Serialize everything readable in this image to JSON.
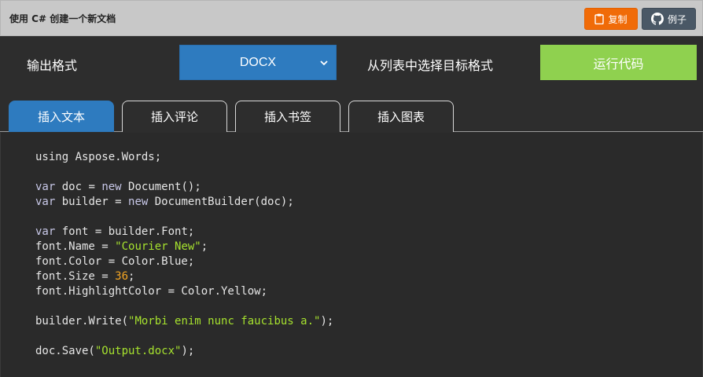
{
  "window": {
    "title": "使用 C# 创建一个新文档"
  },
  "toolbar": {
    "copy_label": "复制",
    "example_label": "例子",
    "copy_color": "#f06b08",
    "example_color": "#4a5866"
  },
  "controls": {
    "output_format_label": "输出格式",
    "format_selected": "DOCX",
    "hint": "从列表中选择目标格式",
    "run_label": "运行代码",
    "run_color": "#8fd14f",
    "select_color": "#2e7bbf"
  },
  "tabs": [
    {
      "label": "插入文本",
      "active": true
    },
    {
      "label": "插入评论",
      "active": false
    },
    {
      "label": "插入书签",
      "active": false
    },
    {
      "label": "插入图表",
      "active": false
    }
  ],
  "code": {
    "lines": [
      [
        {
          "t": "using Aspose.Words;",
          "c": ""
        }
      ],
      [],
      [
        {
          "t": "var",
          "c": "kw"
        },
        {
          "t": " doc = ",
          "c": ""
        },
        {
          "t": "new",
          "c": "kw"
        },
        {
          "t": " Document();",
          "c": ""
        }
      ],
      [
        {
          "t": "var",
          "c": "kw"
        },
        {
          "t": " builder = ",
          "c": ""
        },
        {
          "t": "new",
          "c": "kw"
        },
        {
          "t": " DocumentBuilder(doc);",
          "c": ""
        }
      ],
      [],
      [
        {
          "t": "var",
          "c": "kw"
        },
        {
          "t": " font = builder.Font;",
          "c": ""
        }
      ],
      [
        {
          "t": "font.Name = ",
          "c": ""
        },
        {
          "t": "\"Courier New\"",
          "c": "str"
        },
        {
          "t": ";",
          "c": ""
        }
      ],
      [
        {
          "t": "font.Color = Color.Blue;",
          "c": ""
        }
      ],
      [
        {
          "t": "font.Size = ",
          "c": ""
        },
        {
          "t": "36",
          "c": "num"
        },
        {
          "t": ";",
          "c": ""
        }
      ],
      [
        {
          "t": "font.HighlightColor = Color.Yellow;",
          "c": ""
        }
      ],
      [],
      [
        {
          "t": "builder.Write(",
          "c": ""
        },
        {
          "t": "\"Morbi enim nunc faucibus a.\"",
          "c": "str"
        },
        {
          "t": ");",
          "c": ""
        }
      ],
      [],
      [
        {
          "t": "doc.Save(",
          "c": ""
        },
        {
          "t": "\"Output.docx\"",
          "c": "str"
        },
        {
          "t": ");",
          "c": ""
        }
      ]
    ]
  }
}
